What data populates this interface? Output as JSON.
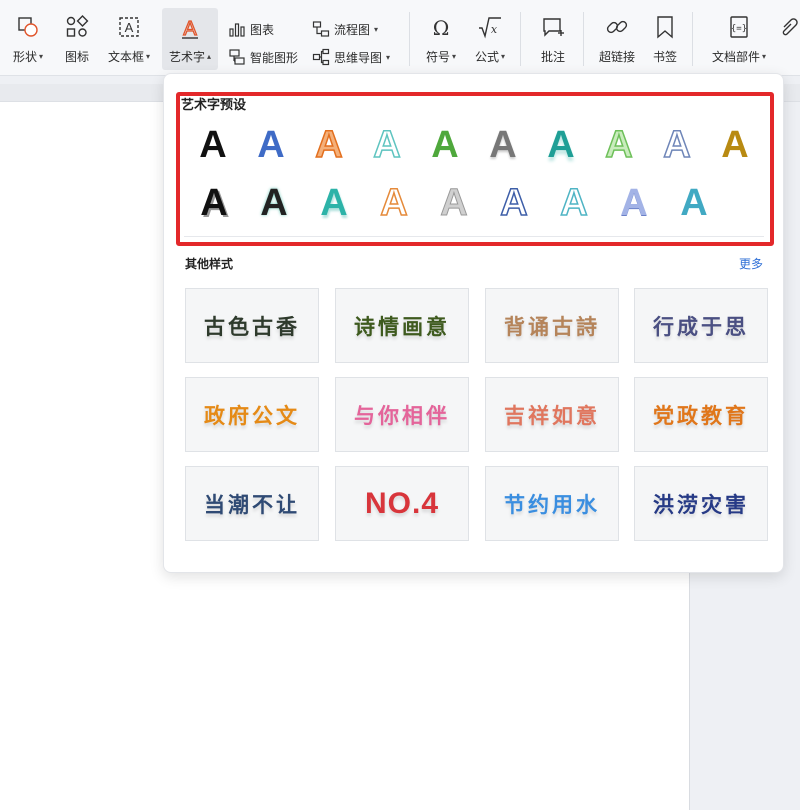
{
  "ribbon": {
    "shape": {
      "label": "形状",
      "icon": "shapes-icon"
    },
    "icon": {
      "label": "图标",
      "icon": "icons-grid-icon"
    },
    "textbox": {
      "label": "文本框",
      "icon": "textbox-icon"
    },
    "wordart": {
      "label": "艺术字",
      "icon": "wordart-icon"
    },
    "chart": {
      "label": "图表",
      "icon": "chart-icon"
    },
    "smartart": {
      "label": "智能图形",
      "icon": "smartart-icon"
    },
    "flowchart": {
      "label": "流程图",
      "icon": "flowchart-icon"
    },
    "mindmap": {
      "label": "思维导图",
      "icon": "mindmap-icon"
    },
    "symbol": {
      "label": "符号",
      "icon": "omega-icon"
    },
    "formula": {
      "label": "公式",
      "icon": "sqrt-x-icon"
    },
    "comment": {
      "label": "批注",
      "icon": "comment-add-icon"
    },
    "hyperlink": {
      "label": "超链接",
      "icon": "link-icon"
    },
    "bookmark": {
      "label": "书签",
      "icon": "bookmark-icon"
    },
    "docparts": {
      "label": "文档部件",
      "icon": "docparts-icon"
    }
  },
  "wordart_panel": {
    "preset_title": "艺术字预设",
    "preset_glyph": "A",
    "other_title": "其他样式",
    "more_label": "更多",
    "styles": [
      {
        "text": "古色古香",
        "color": "#2e3a2c"
      },
      {
        "text": "诗情画意",
        "color": "#3e5a1e"
      },
      {
        "text": "背诵古詩",
        "color": "#b5845a"
      },
      {
        "text": "行成于思",
        "color": "#4a4f82"
      },
      {
        "text": "政府公文",
        "color": "#e58a16"
      },
      {
        "text": "与你相伴",
        "color": "#e4649a"
      },
      {
        "text": "吉祥如意",
        "color": "#e0765e"
      },
      {
        "text": "党政教育",
        "color": "#e0761a"
      },
      {
        "text": "当潮不让",
        "color": "#2f4a74"
      },
      {
        "text": "NO.4",
        "color": "#d8353b"
      },
      {
        "text": "节约用水",
        "color": "#3a8ee0"
      },
      {
        "text": "洪涝灾害",
        "color": "#263a86"
      }
    ]
  },
  "colors": {
    "highlight": "#e3282a",
    "link": "#2f6fd6"
  }
}
